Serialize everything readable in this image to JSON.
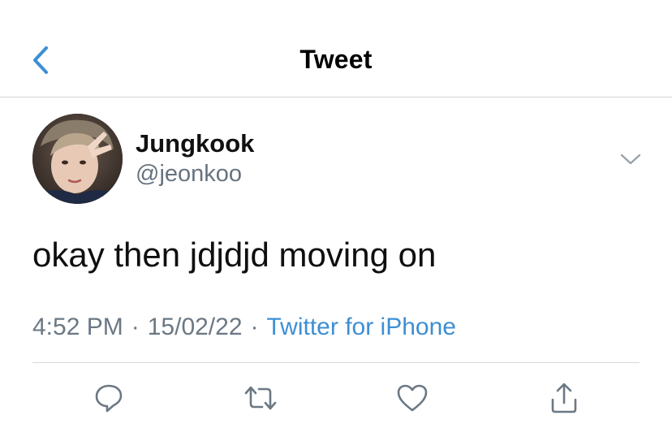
{
  "nav": {
    "title": "Tweet",
    "back_icon": "chevron-left-icon"
  },
  "tweet": {
    "author_name": "Jungkook",
    "author_handle": "@jeonkoo",
    "text": "okay then jdjdjd moving on",
    "time": "4:52 PM",
    "date": "15/02/22",
    "separator": "·",
    "source": "Twitter for iPhone"
  },
  "actions": {
    "reply_icon": "reply-icon",
    "retweet_icon": "retweet-icon",
    "like_icon": "heart-icon",
    "share_icon": "share-icon"
  },
  "colors": {
    "accent": "#3d8fd4",
    "secondary_text": "#66737f",
    "icon_gray": "#6b7884",
    "divider": "#d8d8dc"
  }
}
